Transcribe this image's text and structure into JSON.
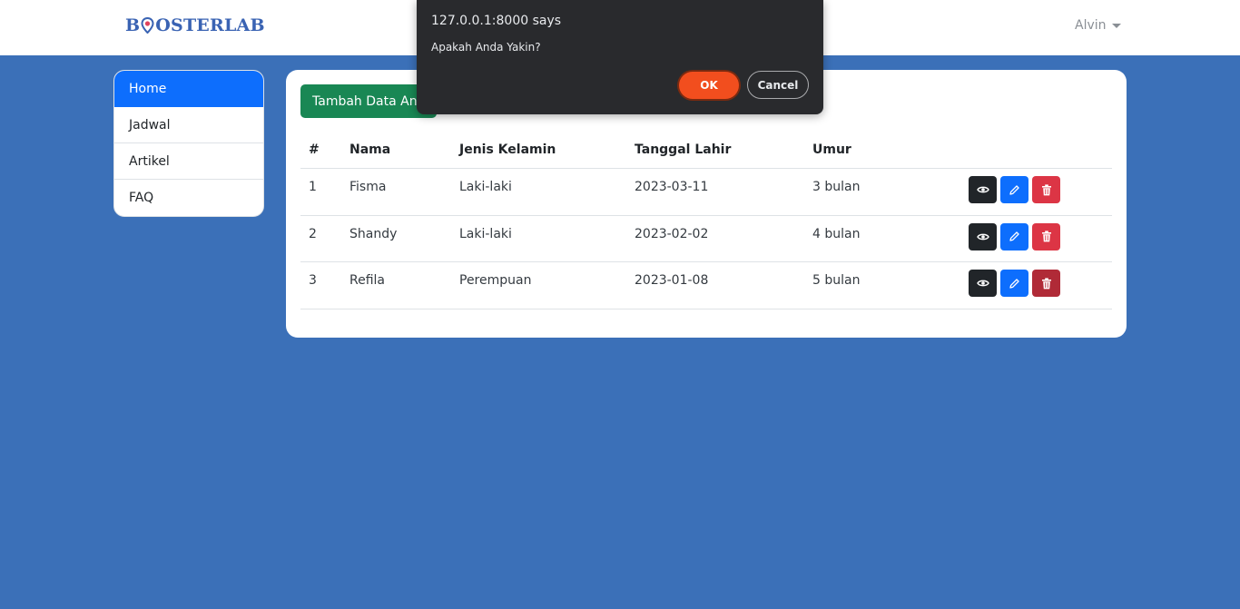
{
  "navbar": {
    "brand_prefix": "B",
    "brand_suffix": "OSTERLAB",
    "user_name": "Alvin"
  },
  "sidebar": {
    "items": [
      {
        "label": "Home",
        "active": true
      },
      {
        "label": "Jadwal",
        "active": false
      },
      {
        "label": "Artikel",
        "active": false
      },
      {
        "label": "FAQ",
        "active": false
      }
    ]
  },
  "main": {
    "add_button_label": "Tambah Data Ana",
    "table": {
      "headers": [
        "#",
        "Nama",
        "Jenis Kelamin",
        "Tanggal Lahir",
        "Umur"
      ],
      "rows": [
        [
          "1",
          "Fisma",
          "Laki-laki",
          "2023-03-11",
          "3 bulan"
        ],
        [
          "2",
          "Shandy",
          "Laki-laki",
          "2023-02-02",
          "4 bulan"
        ],
        [
          "3",
          "Refila",
          "Perempuan",
          "2023-01-08",
          "5 bulan"
        ]
      ]
    }
  },
  "dialog": {
    "title": "127.0.0.1:8000 says",
    "message": "Apakah Anda Yakin?",
    "ok_label": "OK",
    "cancel_label": "Cancel"
  },
  "icons": {
    "view": "eye-icon",
    "edit": "pencil-icon",
    "delete": "trash-icon",
    "brand_o": "map-pin-icon",
    "user_caret": "caret-down-icon"
  },
  "colors": {
    "page_bg": "#3b70b8",
    "primary": "#0d6efd",
    "success": "#198754",
    "danger": "#dc3545",
    "dark": "#212529",
    "dialog_ok": "#f24e1e"
  }
}
